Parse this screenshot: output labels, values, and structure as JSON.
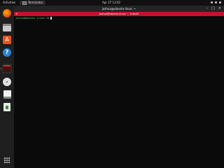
{
  "topbar": {
    "activities": "Activities",
    "app_menu": "Terminator",
    "clock": "Apr 27  13:02"
  },
  "dock": {
    "items": [
      "firefox",
      "files",
      "ubuntu-software",
      "help",
      "terminator",
      "disc",
      "libreoffice-writer",
      "trash",
      "show-applications"
    ]
  },
  "window": {
    "title": "joshua@ubuntu-linux: ~",
    "tab_title": "joshua@ubuntu-linux: ~ 116x45",
    "prompt_user": "joshua@ubuntu-linux",
    "prompt_sep": ":",
    "prompt_path": "~",
    "prompt_symbol": "$ "
  },
  "colors": {
    "tab_red": "#c8102e",
    "accent_orange": "#e95420"
  }
}
